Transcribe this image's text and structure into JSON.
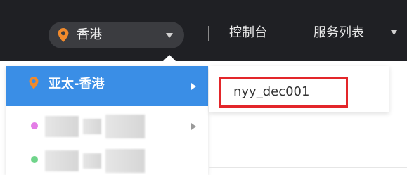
{
  "topbar": {
    "region_selector": {
      "label": "香港",
      "pin_icon": "location-pin-icon",
      "caret_icon": "caret-down-icon"
    },
    "nav": {
      "console_label": "控制台",
      "services_label": "服务列表",
      "services_caret_icon": "caret-down-icon"
    }
  },
  "region_dropdown": {
    "items": [
      {
        "label": "亚太-香港",
        "active": true,
        "icon": "location-pin-icon",
        "has_submenu": true
      },
      {
        "label": "",
        "blurred": true,
        "dot_color": "#e37de6",
        "has_submenu": true
      },
      {
        "label": "",
        "blurred": true,
        "dot_color": "#6fd48a",
        "has_submenu": false
      }
    ]
  },
  "project_panel": {
    "items": [
      {
        "label": "nyy_dec001",
        "highlighted": true
      }
    ]
  },
  "colors": {
    "topbar_bg": "#1f2024",
    "selector_bg": "#3b3c40",
    "active_item_bg": "#3a8ee6",
    "pin_orange": "#f08a2c",
    "highlight_border": "#e3262a"
  }
}
